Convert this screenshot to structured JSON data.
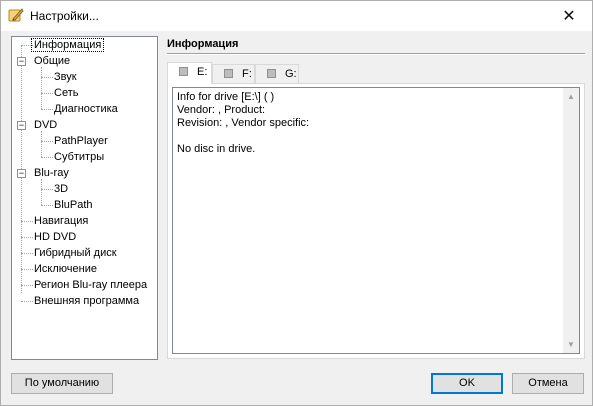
{
  "window": {
    "title": "Настройки...",
    "close_glyph": "✕"
  },
  "tree": {
    "items": [
      {
        "label": "Информация",
        "level": 0
      },
      {
        "label": "Общие",
        "level": 0,
        "expander": "−"
      },
      {
        "label": "Звук",
        "level": 1
      },
      {
        "label": "Сеть",
        "level": 1
      },
      {
        "label": "Диагностика",
        "level": 1
      },
      {
        "label": "DVD",
        "level": 0,
        "expander": "−"
      },
      {
        "label": "PathPlayer",
        "level": 1
      },
      {
        "label": "Субтитры",
        "level": 1
      },
      {
        "label": "Blu-ray",
        "level": 0,
        "expander": "−"
      },
      {
        "label": "3D",
        "level": 1
      },
      {
        "label": "BluPath",
        "level": 1
      },
      {
        "label": "Навигация",
        "level": 0
      },
      {
        "label": "HD DVD",
        "level": 0
      },
      {
        "label": "Гибридный диск",
        "level": 0
      },
      {
        "label": "Исключение",
        "level": 0
      },
      {
        "label": "Регион Blu-ray плеера",
        "level": 0
      },
      {
        "label": "Внешняя программа",
        "level": 0
      }
    ]
  },
  "panel": {
    "title": "Информация",
    "tabs": [
      {
        "label": "E:"
      },
      {
        "label": "F:"
      },
      {
        "label": "G:"
      }
    ],
    "text_lines": [
      "Info for drive [E:\\] ( )",
      "Vendor: , Product:",
      "Revision: , Vendor specific:",
      "",
      "No disc in drive."
    ],
    "scroll_up_glyph": "▲",
    "scroll_down_glyph": "▼"
  },
  "buttons": {
    "defaults_label": "По умолчанию",
    "ok_label": "OK",
    "cancel_label": "Отмена"
  },
  "colors": {
    "accent": "#0078d7"
  }
}
